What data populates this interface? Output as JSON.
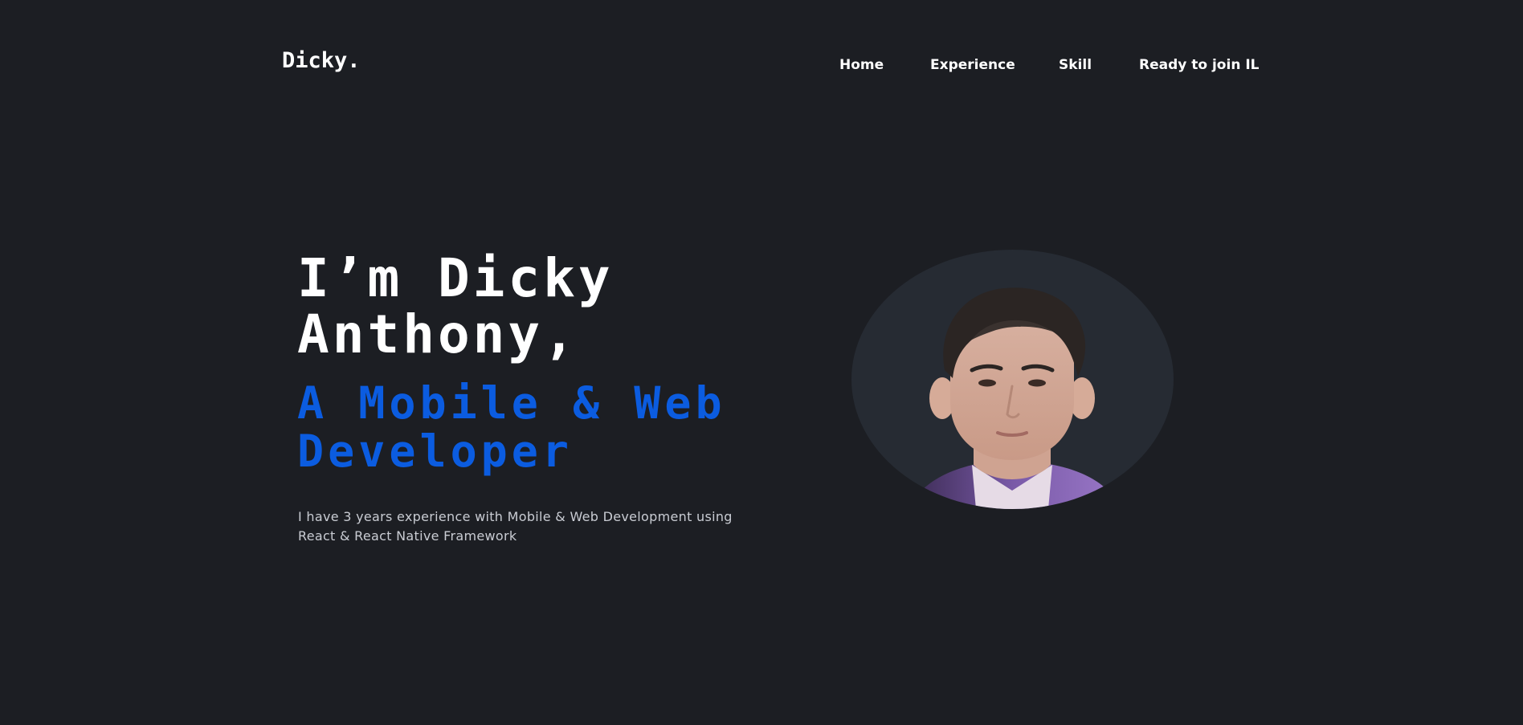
{
  "header": {
    "logo": "Dicky.",
    "nav": [
      "Home",
      "Experience",
      "Skill",
      "Ready to join IL"
    ]
  },
  "hero": {
    "title_line1": "I’m Dicky",
    "title_line2": "Anthony,",
    "subtitle_line1": "A Mobile & Web",
    "subtitle_line2": "Developer",
    "description_line1": "I have 3 years experience with Mobile & Web Development using",
    "description_line2": "React & React Native Framework"
  },
  "colors": {
    "background": "#1c1e23",
    "accent": "#0b5ce0",
    "avatar_bg": "#262b33"
  },
  "icons": {
    "avatar": "portrait-photo"
  }
}
